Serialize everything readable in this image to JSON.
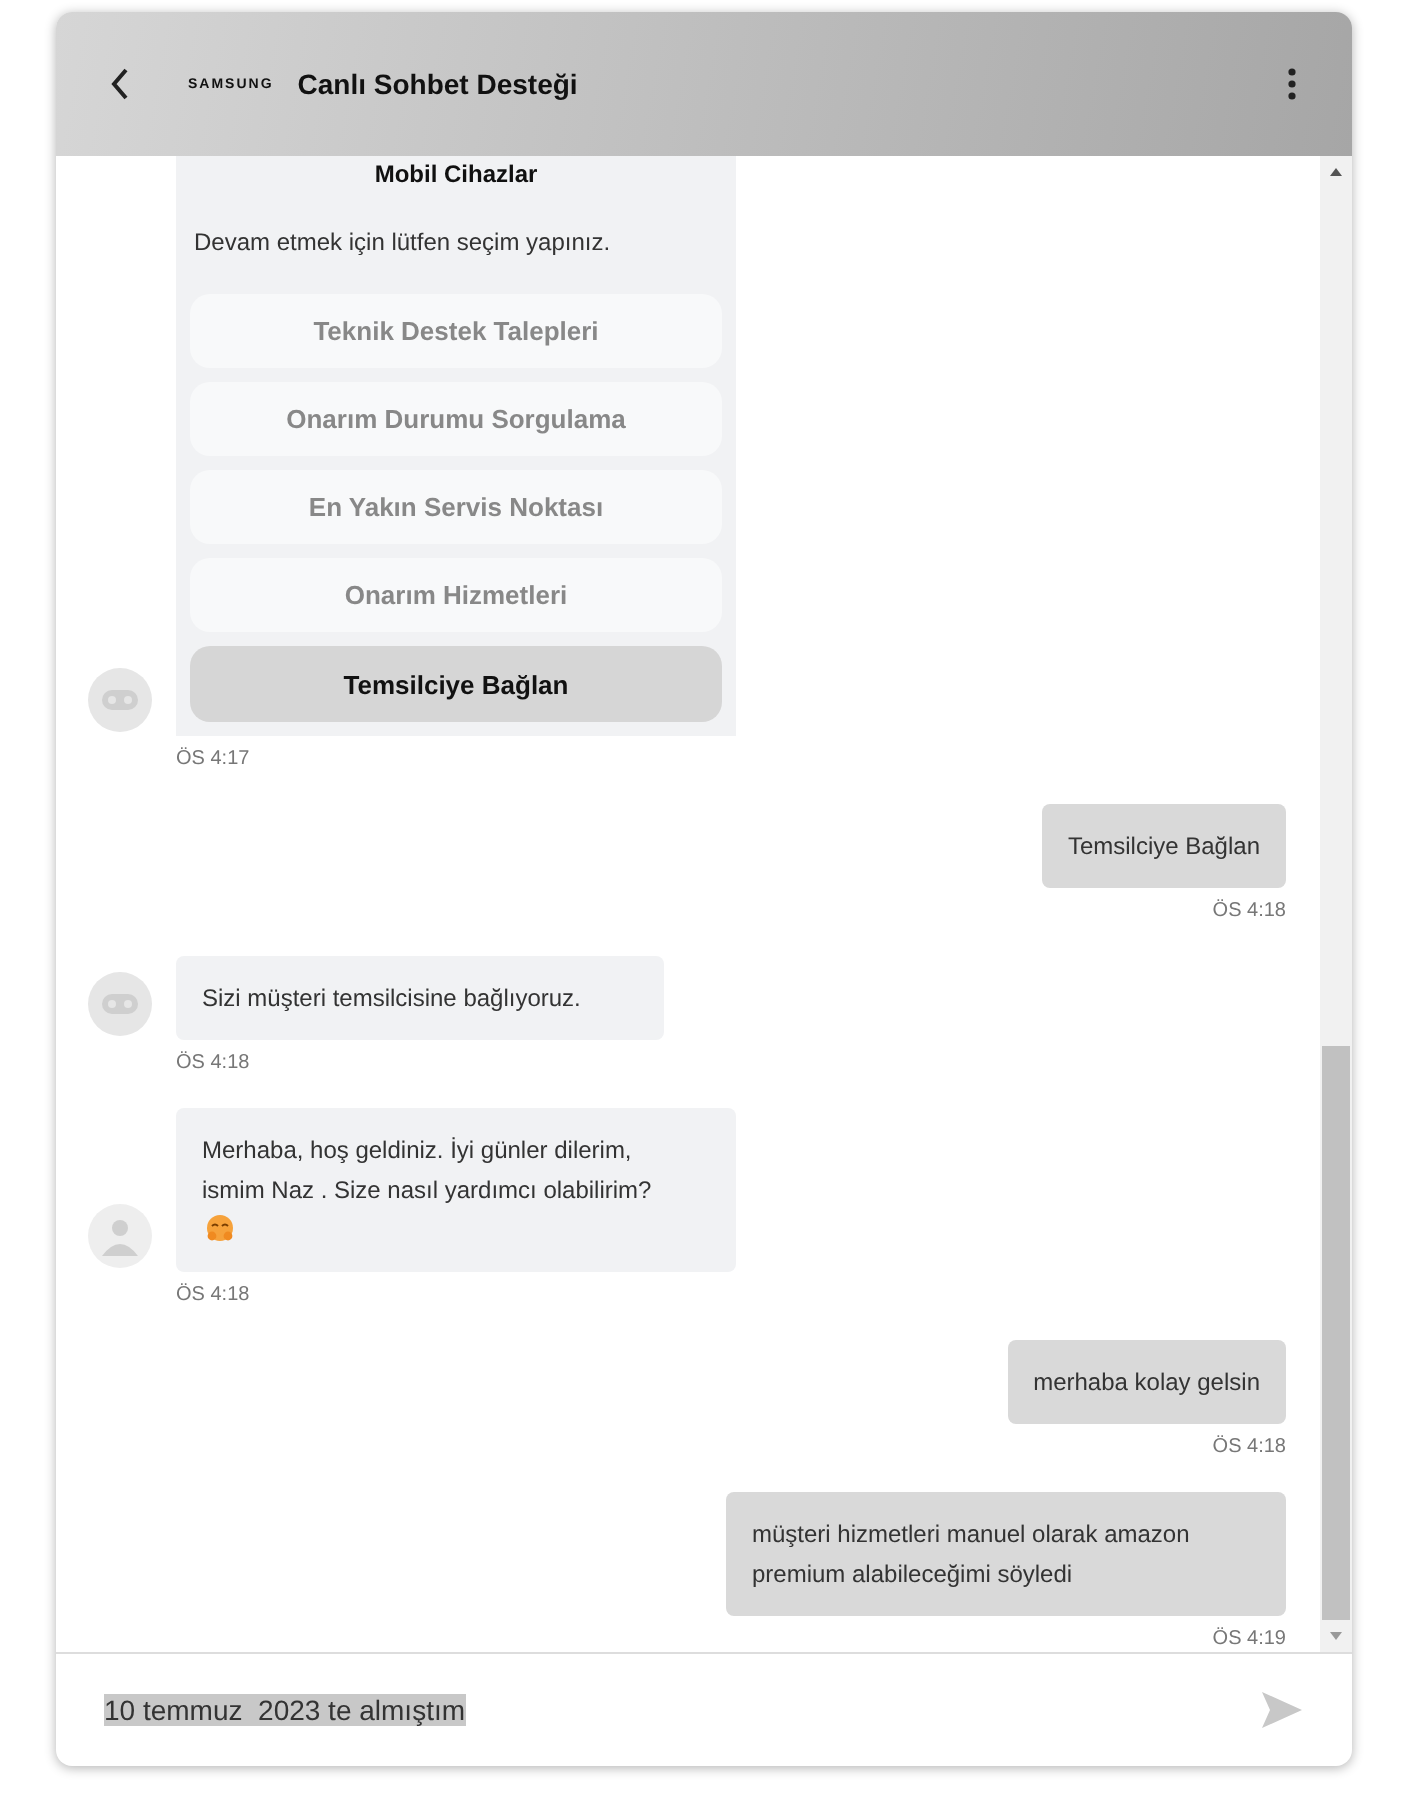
{
  "header": {
    "brand": "SAMSUNG",
    "title": "Canlı Sohbet Desteği"
  },
  "messages": [
    {
      "kind": "menu",
      "avatar": {
        "kind": "bot"
      },
      "title": "Mobil Cihazlar",
      "prompt": "Devam etmek için lütfen seçim yapınız.",
      "options": [
        {
          "label": "Teknik Destek Talepleri",
          "selected": false
        },
        {
          "label": "Onarım Durumu Sorgulama",
          "selected": false
        },
        {
          "label": "En Yakın Servis Noktası",
          "selected": false
        },
        {
          "label": "Onarım Hizmetleri",
          "selected": false
        },
        {
          "label": "Temsilciye Bağlan",
          "selected": true
        }
      ],
      "time": "ÖS 4:17"
    },
    {
      "kind": "user",
      "text": "Temsilciye Bağlan",
      "time": "ÖS 4:18"
    },
    {
      "kind": "bot",
      "avatar": {
        "kind": "bot"
      },
      "text": "Sizi müşteri temsilcisine bağlıyoruz.",
      "time": "ÖS 4:18"
    },
    {
      "kind": "bot",
      "avatar": {
        "kind": "person"
      },
      "text": "Merhaba, hoş geldiniz. İyi günler dilerim, ismim Naz . Size nasıl yardımcı olabilirim?",
      "emoji": true,
      "time": "ÖS 4:18"
    },
    {
      "kind": "user",
      "text": "merhaba kolay gelsin",
      "time": "ÖS 4:18"
    },
    {
      "kind": "user",
      "text": "müşteri hizmetleri manuel olarak amazon premium alabileceğimi söyledi",
      "time": "ÖS 4:19"
    }
  ],
  "input": {
    "value": "10 temmuz  2023 te almıştım",
    "selected": true
  }
}
